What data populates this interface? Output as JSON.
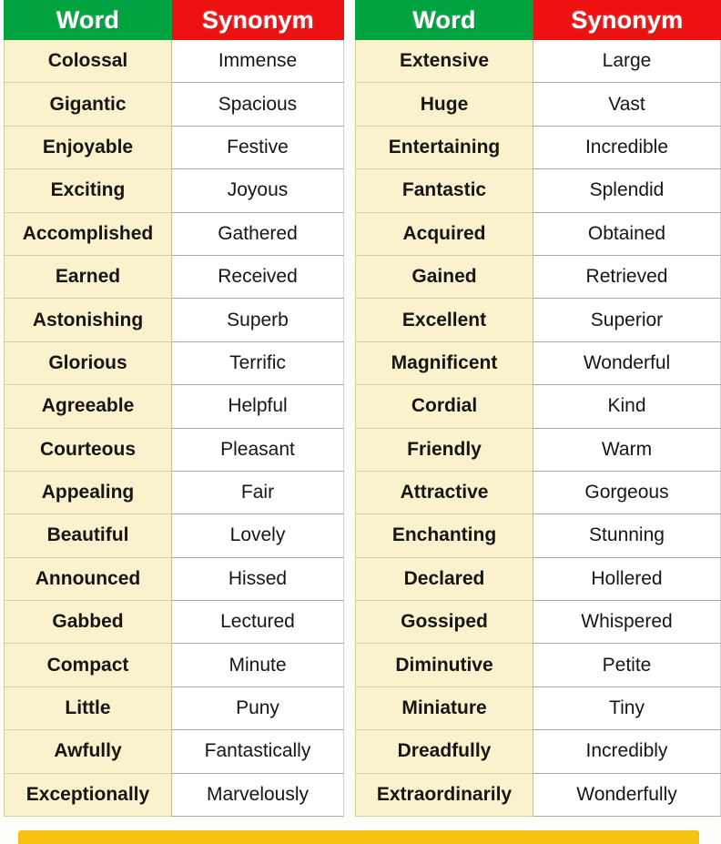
{
  "colors": {
    "header_word_bg": "#00a33f",
    "header_synonym_bg": "#ee1111",
    "header_text": "#ffffff",
    "word_cell_bg": "#f9f2cd",
    "synonym_cell_bg": "#ffffff",
    "body_text": "#161616",
    "bottom_bar": "#f5c211"
  },
  "tables": [
    {
      "id": "left",
      "headers": {
        "word": "Word",
        "synonym": "Synonym"
      },
      "rows": [
        {
          "word": "Colossal",
          "synonym": "Immense"
        },
        {
          "word": "Gigantic",
          "synonym": "Spacious"
        },
        {
          "word": "Enjoyable",
          "synonym": "Festive"
        },
        {
          "word": "Exciting",
          "synonym": "Joyous"
        },
        {
          "word": "Accomplished",
          "synonym": "Gathered"
        },
        {
          "word": "Earned",
          "synonym": "Received"
        },
        {
          "word": "Astonishing",
          "synonym": "Superb"
        },
        {
          "word": "Glorious",
          "synonym": "Terrific"
        },
        {
          "word": "Agreeable",
          "synonym": "Helpful"
        },
        {
          "word": "Courteous",
          "synonym": "Pleasant"
        },
        {
          "word": "Appealing",
          "synonym": "Fair"
        },
        {
          "word": "Beautiful",
          "synonym": "Lovely"
        },
        {
          "word": "Announced",
          "synonym": "Hissed"
        },
        {
          "word": "Gabbed",
          "synonym": "Lectured"
        },
        {
          "word": "Compact",
          "synonym": "Minute"
        },
        {
          "word": "Little",
          "synonym": "Puny"
        },
        {
          "word": "Awfully",
          "synonym": "Fantastically"
        },
        {
          "word": "Exceptionally",
          "synonym": "Marvelously"
        }
      ]
    },
    {
      "id": "right",
      "headers": {
        "word": "Word",
        "synonym": "Synonym"
      },
      "rows": [
        {
          "word": "Extensive",
          "synonym": "Large"
        },
        {
          "word": "Huge",
          "synonym": "Vast"
        },
        {
          "word": "Entertaining",
          "synonym": "Incredible"
        },
        {
          "word": "Fantastic",
          "synonym": "Splendid"
        },
        {
          "word": "Acquired",
          "synonym": "Obtained"
        },
        {
          "word": "Gained",
          "synonym": "Retrieved"
        },
        {
          "word": "Excellent",
          "synonym": "Superior"
        },
        {
          "word": "Magnificent",
          "synonym": "Wonderful"
        },
        {
          "word": "Cordial",
          "synonym": "Kind"
        },
        {
          "word": "Friendly",
          "synonym": "Warm"
        },
        {
          "word": "Attractive",
          "synonym": "Gorgeous"
        },
        {
          "word": "Enchanting",
          "synonym": "Stunning"
        },
        {
          "word": "Declared",
          "synonym": "Hollered"
        },
        {
          "word": "Gossiped",
          "synonym": "Whispered"
        },
        {
          "word": "Diminutive",
          "synonym": "Petite"
        },
        {
          "word": "Miniature",
          "synonym": "Tiny"
        },
        {
          "word": "Dreadfully",
          "synonym": "Incredibly"
        },
        {
          "word": "Extraordinarily",
          "synonym": "Wonderfully"
        }
      ]
    }
  ]
}
